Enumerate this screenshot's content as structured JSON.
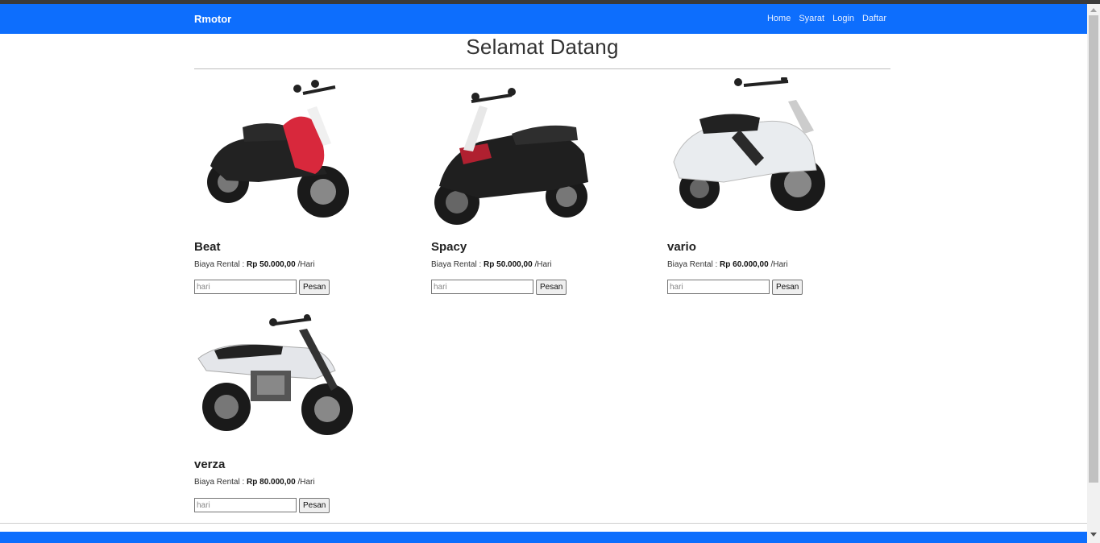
{
  "navbar": {
    "brand": "Rmotor",
    "links": [
      "Home",
      "Syarat",
      "Login",
      "Daftar"
    ]
  },
  "main": {
    "title": "Selamat Datang"
  },
  "products": [
    {
      "name": "Beat",
      "price_label": "Biaya Rental :",
      "price": "Rp 50.000,00",
      "unit": "/Hari",
      "input_placeholder": "hari",
      "button_label": "Pesan",
      "body_color": "#d8283c"
    },
    {
      "name": "Spacy",
      "price_label": "Biaya Rental :",
      "price": "Rp 50.000,00",
      "unit": "/Hari",
      "input_placeholder": "hari",
      "button_label": "Pesan",
      "body_color": "#1f1f1f"
    },
    {
      "name": "vario",
      "price_label": "Biaya Rental :",
      "price": "Rp 60.000,00",
      "unit": "/Hari",
      "input_placeholder": "hari",
      "button_label": "Pesan",
      "body_color": "#e9ecef"
    },
    {
      "name": "verza",
      "price_label": "Biaya Rental :",
      "price": "Rp 80.000,00",
      "unit": "/Hari",
      "input_placeholder": "hari",
      "button_label": "Pesan",
      "body_color": "#e4e6ea"
    }
  ],
  "colors": {
    "primary": "#0d6efd"
  }
}
